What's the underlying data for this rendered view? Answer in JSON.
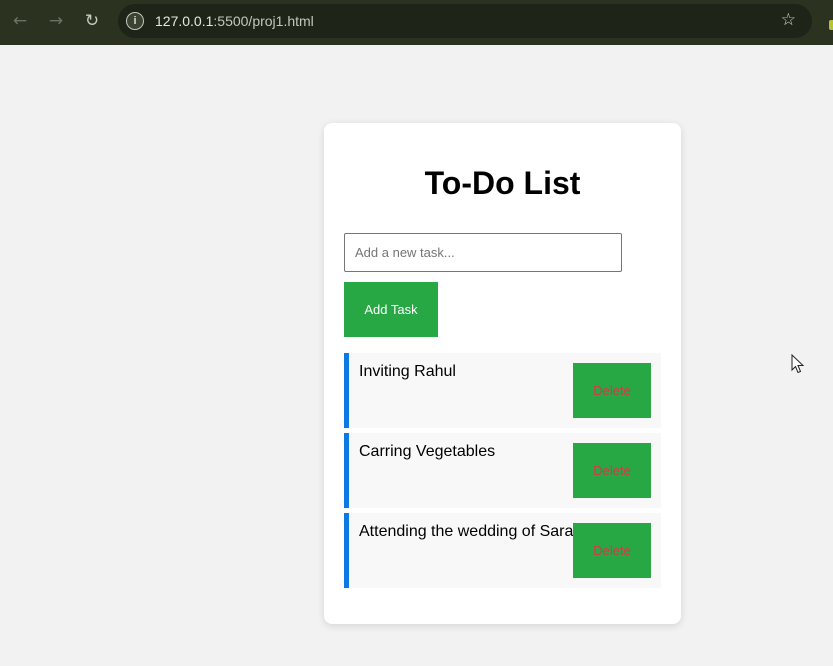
{
  "browser": {
    "url_host": "127.0.0.1",
    "url_rest": ":5500/proj1.html",
    "back_icon": "arrow-left-icon",
    "forward_icon": "arrow-right-icon",
    "reload_icon": "reload-icon",
    "info_icon": "info-icon",
    "bookmark_icon": "star-icon"
  },
  "app": {
    "title": "To-Do List",
    "input_placeholder": "Add a new task...",
    "input_value": "",
    "add_button_label": "Add Task",
    "tasks": [
      {
        "text": "Inviting Rahul",
        "delete_label": "Delete"
      },
      {
        "text": "Carring Vegetables",
        "delete_label": "Delete"
      },
      {
        "text": "Attending the wedding of Sarah",
        "delete_label": "Delete"
      }
    ]
  },
  "colors": {
    "page_background": "#f2f2f2",
    "browser_bar": "#2b3320",
    "accent_green": "#28a745",
    "task_border_blue": "#0b78e3",
    "delete_text_red": "#dc3545"
  }
}
